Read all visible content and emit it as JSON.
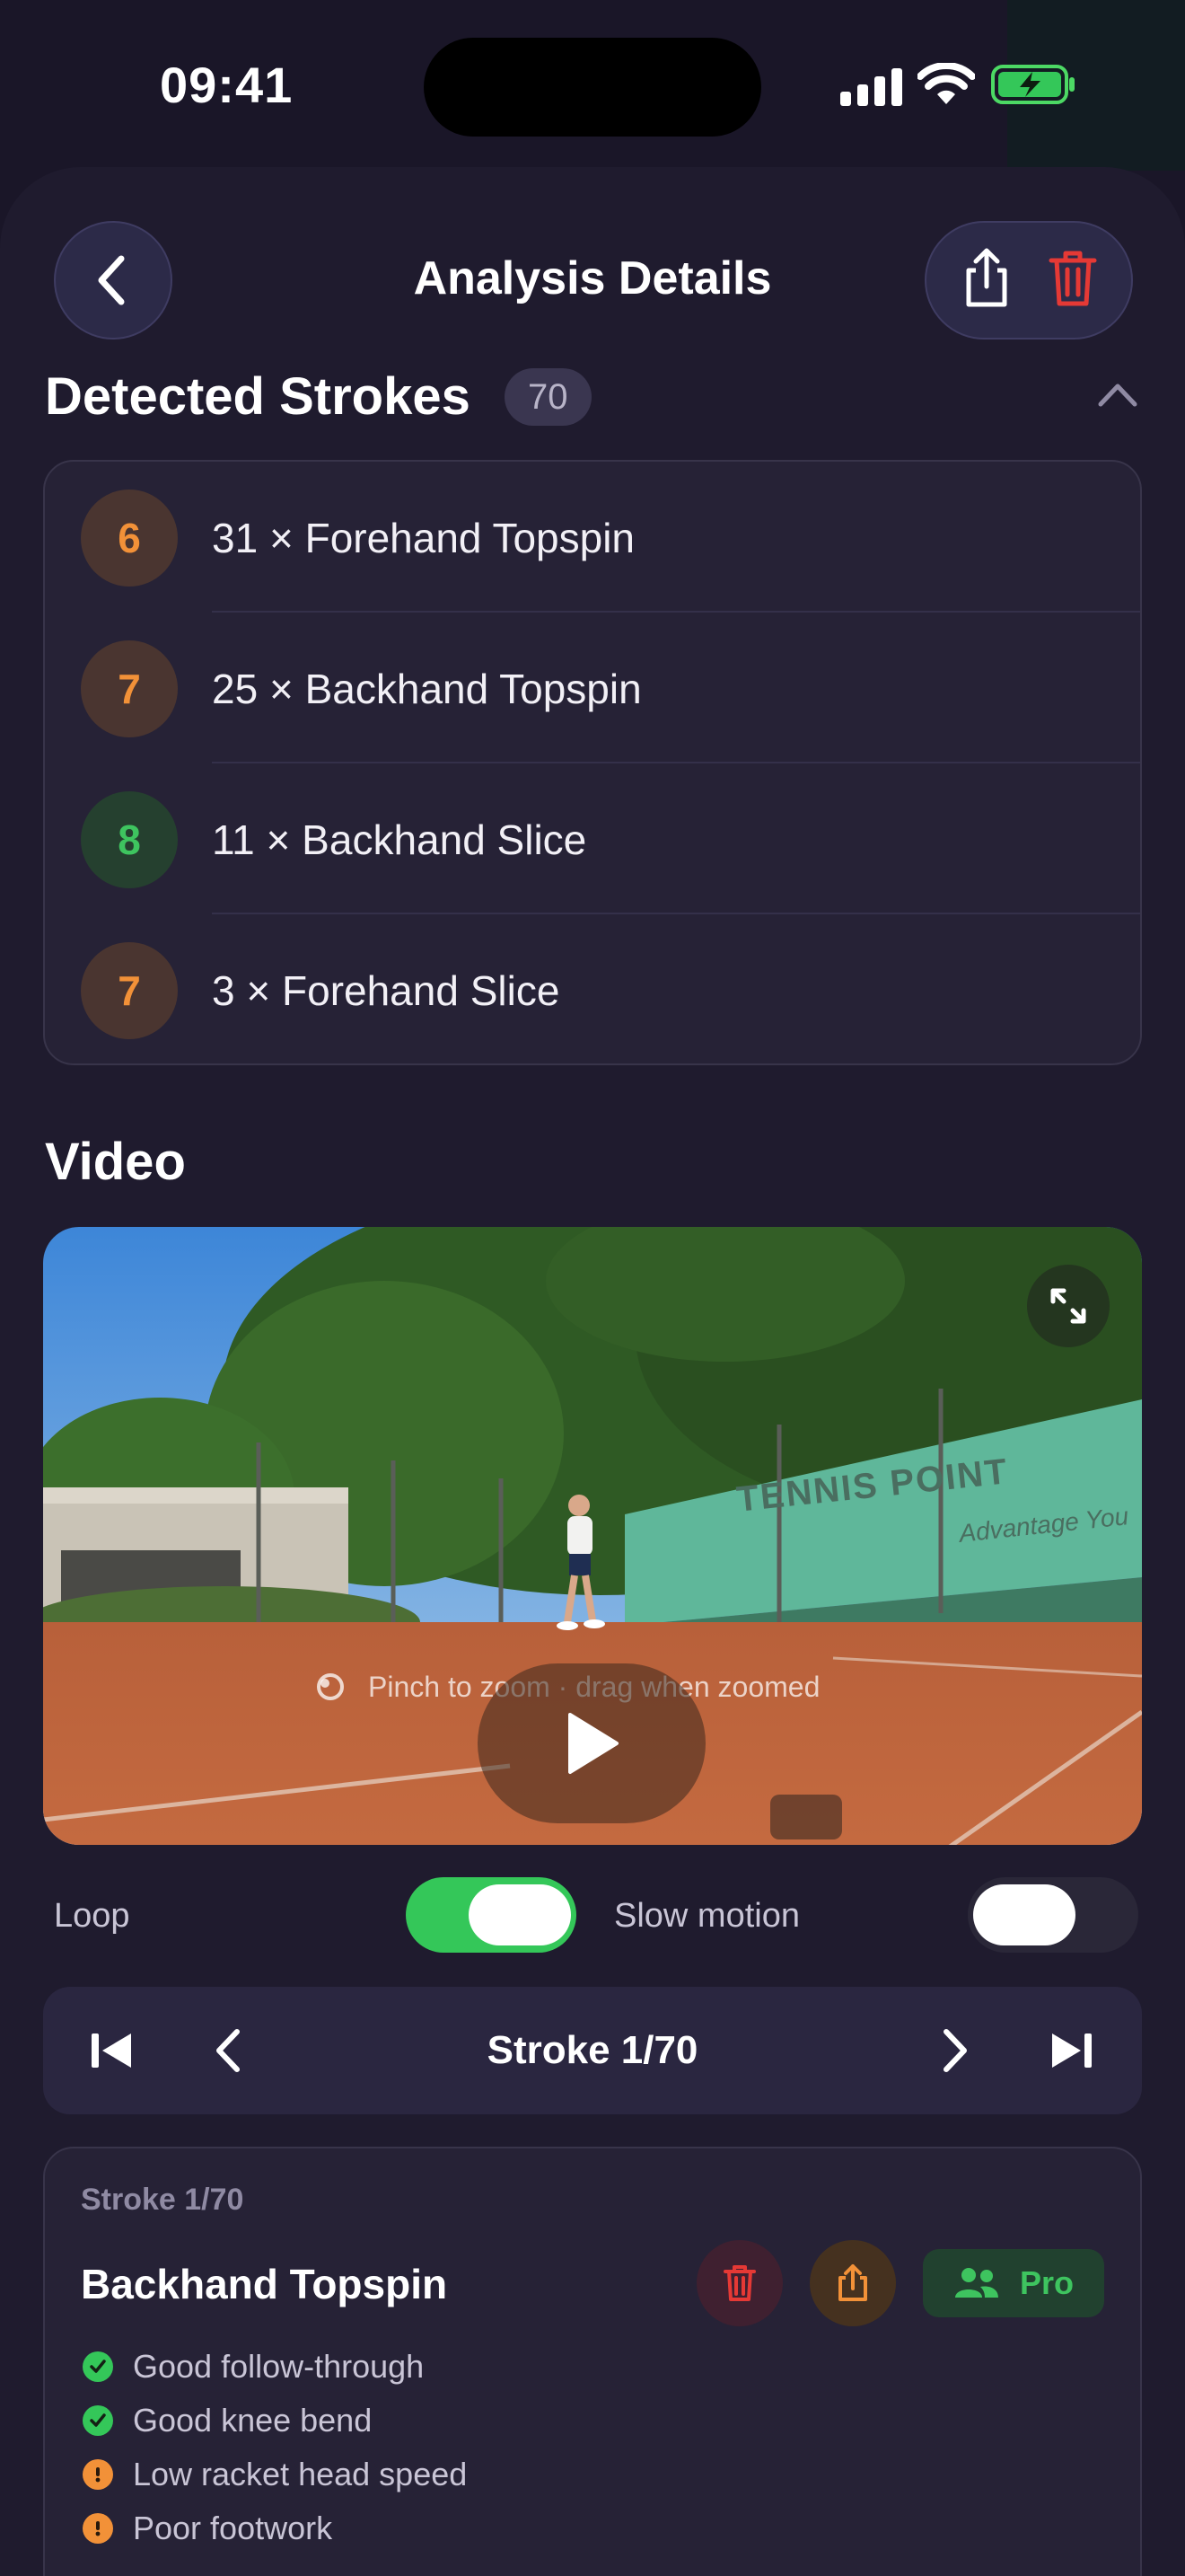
{
  "status_bar": {
    "time": "09:41"
  },
  "header": {
    "title": "Analysis Details"
  },
  "detected_strokes": {
    "title": "Detected Strokes",
    "count": "70",
    "items": [
      {
        "grade": "6",
        "grade_color": "#f29138",
        "label": "31 × Forehand Topspin"
      },
      {
        "grade": "7",
        "grade_color": "#f29138",
        "label": "25 × Backhand Topspin"
      },
      {
        "grade": "8",
        "grade_color": "#3ec45f",
        "label": "11 × Backhand Slice"
      },
      {
        "grade": "7",
        "grade_color": "#f29138",
        "label": "3 × Forehand Slice"
      }
    ]
  },
  "video": {
    "title": "Video",
    "hint": "Pinch to zoom · drag when zoomed",
    "banner_text": "TENNIS POINT",
    "banner_tagline": "Advantage You"
  },
  "toggles": {
    "loop_label": "Loop",
    "loop_on": true,
    "slow_motion_label": "Slow motion",
    "slow_motion_on": false
  },
  "navigator": {
    "label": "Stroke 1/70"
  },
  "stroke_detail": {
    "subtitle": "Stroke 1/70",
    "title": "Backhand Topspin",
    "pro_label": "Pro",
    "feedback": [
      {
        "status": "good",
        "text": "Good follow-through"
      },
      {
        "status": "good",
        "text": "Good knee bend"
      },
      {
        "status": "warn",
        "text": "Low racket head speed"
      },
      {
        "status": "warn",
        "text": "Poor footwork"
      }
    ]
  },
  "colors": {
    "accent_green": "#34c759",
    "accent_orange": "#f29138",
    "danger_red": "#e53935"
  }
}
